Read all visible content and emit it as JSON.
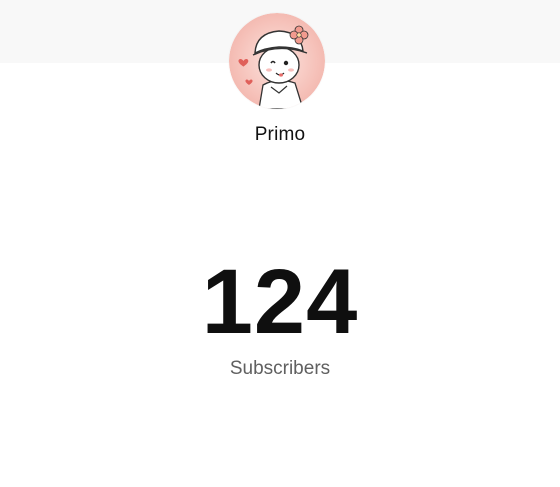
{
  "channel": {
    "name": "Primo",
    "avatar_icon": "chibi-character-avatar"
  },
  "stats": {
    "subscriber_count": "124",
    "subscriber_label": "Subscribers"
  },
  "colors": {
    "avatar_background": "#f7c7c0",
    "heart": "#e0605a",
    "flower": "#f29a8e"
  }
}
